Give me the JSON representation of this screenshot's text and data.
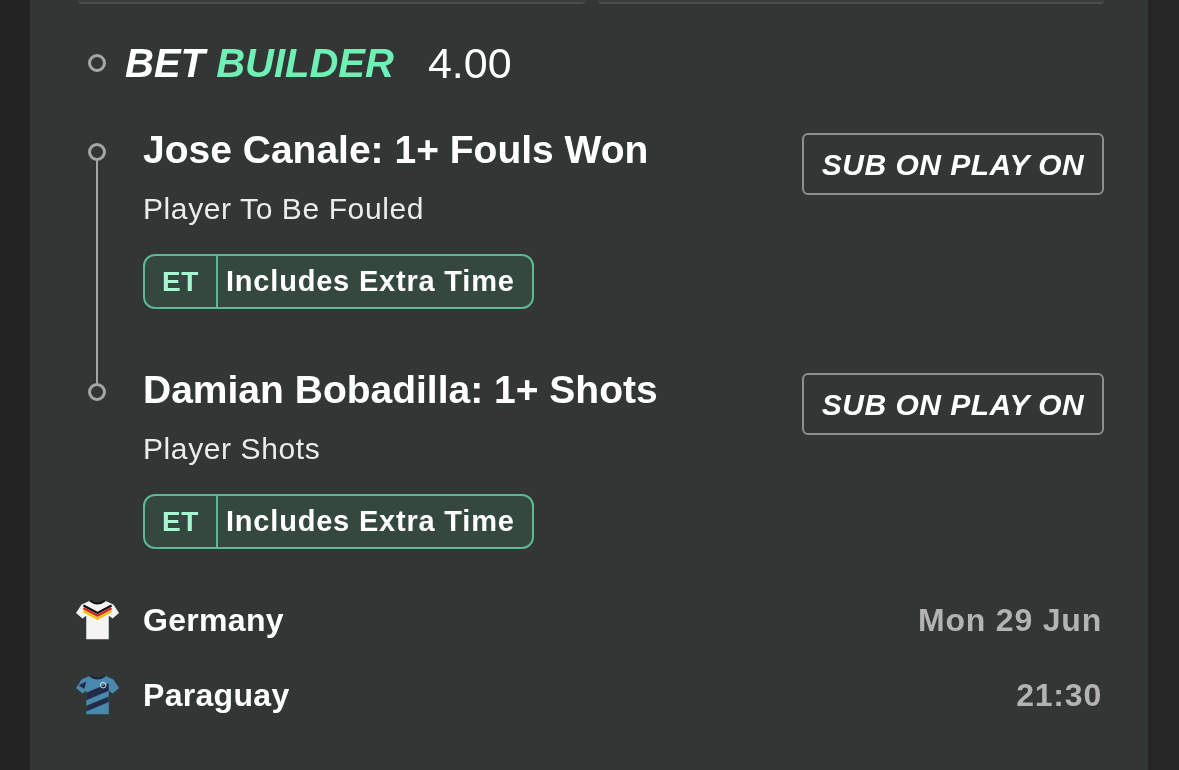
{
  "bet_builder": {
    "title_prefix": "BET",
    "title_highlight": "BUILDER",
    "odds": "4.00"
  },
  "legs": [
    {
      "selection": "Jose Canale: 1+ Fouls Won",
      "market": "Player To Be Fouled",
      "badge": {
        "code": "ET",
        "label": "Includes Extra Time"
      },
      "button": "SUB ON PLAY ON"
    },
    {
      "selection": "Damian Bobadilla: 1+ Shots",
      "market": "Player Shots",
      "badge": {
        "code": "ET",
        "label": "Includes Extra Time"
      },
      "button": "SUB ON PLAY ON"
    }
  ],
  "event": {
    "teams": [
      {
        "name": "Germany",
        "kind": "chevron"
      },
      {
        "name": "Paraguay",
        "kind": "camo"
      }
    ],
    "date": "Mon 29 Jun",
    "time": "21:30"
  }
}
